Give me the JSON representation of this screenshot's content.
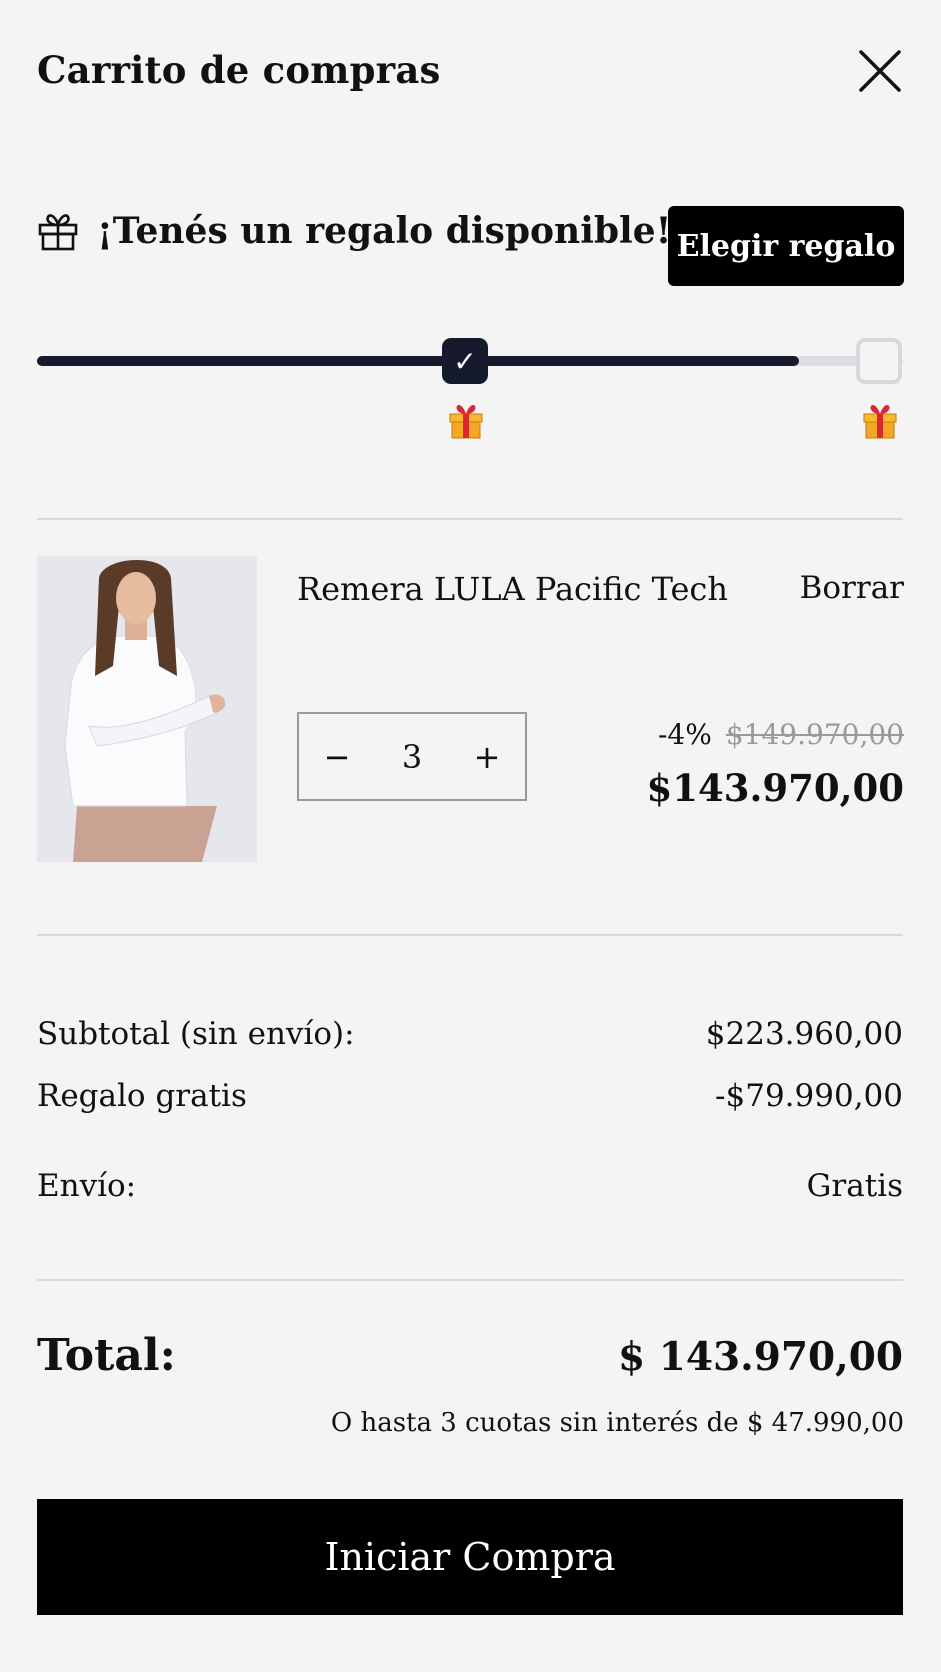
{
  "cart": {
    "title": "Carrito de compras"
  },
  "gift": {
    "message": "¡Tenés un regalo disponible!",
    "button_label": "Elegir regalo",
    "progress": 0.88,
    "milestone_1_mark": "✓"
  },
  "product": {
    "name": "Remera LULA Pacific Tech",
    "remove_label": "Borrar",
    "quantity": "3",
    "decrement_label": "−",
    "increment_label": "+",
    "discount": "-4%",
    "original_price": "$149.970,00",
    "price": "$143.970,00"
  },
  "summary": {
    "subtotal_label": "Subtotal (sin envío):",
    "subtotal_value": "$223.960,00",
    "gift_label": "Regalo gratis",
    "gift_value": "-$79.990,00",
    "shipping_label": "Envío:",
    "shipping_value": "Gratis",
    "total_label": "Total:",
    "total_value": "$ 143.970,00",
    "installments": "O hasta 3 cuotas sin interés de $ 47.990,00"
  },
  "checkout": {
    "button_label": "Iniciar Compra"
  },
  "colors": {
    "progress_fill": "#151b2d",
    "button_bg": "#000000",
    "background": "#f4f4f4"
  },
  "icons": {
    "close": "close-icon",
    "gift_outline": "gift-outline-icon",
    "present": "present-emoji-icon"
  }
}
